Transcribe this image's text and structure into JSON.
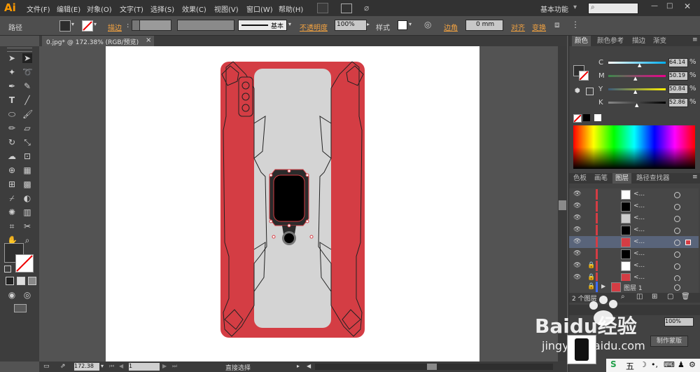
{
  "app": {
    "logo": "Ai"
  },
  "menu": [
    "文件(F)",
    "编辑(E)",
    "对象(O)",
    "文字(T)",
    "选择(S)",
    "效果(C)",
    "视图(V)",
    "窗口(W)",
    "帮助(H)"
  ],
  "workspace": "基本功能",
  "control": {
    "selection_type": "路径",
    "stroke_label": "描边",
    "stroke_profile": "基本",
    "opacity_label": "不透明度",
    "opacity_value": "100%",
    "style_label": "样式",
    "corner_label": "边角",
    "corner_value": "0 mm",
    "align_label": "对齐",
    "transform_label": "变换"
  },
  "document_tab": {
    "title": "0.jpg* @ 172.38% (RGB/预览)",
    "close": "×"
  },
  "status": {
    "zoom": "172.38",
    "page": "1",
    "tool_name": "直接选择"
  },
  "color_panel": {
    "tabs": [
      "颜色",
      "颜色参考",
      "描边",
      "渐变"
    ],
    "channels": [
      {
        "name": "C",
        "value": "64.14",
        "color": "#29b8c6"
      },
      {
        "name": "M",
        "value": "50.19",
        "color": "#c03a87"
      },
      {
        "name": "Y",
        "value": "50.84",
        "color": "#d6d04a"
      },
      {
        "name": "K",
        "value": "52.86",
        "color": "#888888"
      }
    ]
  },
  "layers_panel": {
    "tabs": [
      "色板",
      "画笔",
      "图层",
      "路径查找器"
    ],
    "rows": [
      {
        "label": "<...",
        "thumb": "#ffffff",
        "locked": false
      },
      {
        "label": "<...",
        "thumb": "#000000",
        "locked": false
      },
      {
        "label": "<...",
        "thumb": "#cccccc",
        "locked": false
      },
      {
        "label": "<...",
        "thumb": "#000000",
        "locked": false
      },
      {
        "label": "<...",
        "thumb": "#d43d44",
        "locked": false,
        "selected": true
      },
      {
        "label": "<...",
        "thumb": "#000000",
        "locked": false
      },
      {
        "label": "<...",
        "thumb": "#ffffff",
        "locked": true
      },
      {
        "label": "<...",
        "thumb": "#d43d44",
        "locked": true
      }
    ],
    "group_label": "图层 1",
    "footer": "2 个图层"
  },
  "make_mask": "制作蒙版",
  "watermark": {
    "brand": "Baidu经验",
    "url": "jingyan.baidu.com"
  },
  "taskbar_ime": "五",
  "colors": {
    "phone_red": "#d43d44",
    "phone_grey": "#d4d4d4",
    "accent_orange": "#ff9a00"
  }
}
